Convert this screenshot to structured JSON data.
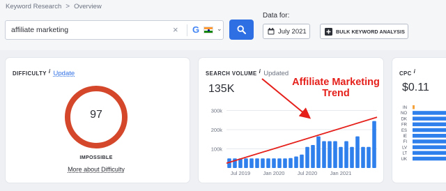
{
  "breadcrumb": {
    "items": [
      "Keyword Research",
      "Overview"
    ],
    "separator": ">"
  },
  "search": {
    "value": "affiliate marketing",
    "engine": "G",
    "country": "India"
  },
  "data_for": {
    "label": "Data for:",
    "date": "July 2021"
  },
  "bulk_button": "BULK KEYWORD ANALYSIS",
  "difficulty": {
    "title": "DIFFICULTY",
    "info": "i",
    "link": "Update",
    "value": "97",
    "level": "IMPOSSIBLE",
    "more": "More about Difficulty",
    "color": "#d4472a"
  },
  "search_volume": {
    "title": "SEARCH VOLUME",
    "info": "i",
    "status": "Updated",
    "value": "135K"
  },
  "cpc": {
    "title": "CPC",
    "info": "i",
    "value": "$0.11"
  },
  "annotation": {
    "line1": "Affiliate Marketing",
    "line2": "Trend",
    "color": "#e5201b"
  },
  "chart_data": [
    {
      "type": "bar",
      "title": "",
      "ytick_labels": [
        "100k",
        "200k",
        "300k"
      ],
      "ylim": [
        0,
        320000
      ],
      "xtick_labels": [
        "Jul 2019",
        "Jan 2020",
        "Jul 2020",
        "Jan 2021"
      ],
      "categories": [
        "May 2019",
        "Jun 2019",
        "Jul 2019",
        "Aug 2019",
        "Sep 2019",
        "Oct 2019",
        "Nov 2019",
        "Dec 2019",
        "Jan 2020",
        "Feb 2020",
        "Mar 2020",
        "Apr 2020",
        "May 2020",
        "Jun 2020",
        "Jul 2020",
        "Aug 2020",
        "Sep 2020",
        "Oct 2020",
        "Nov 2020",
        "Dec 2020",
        "Jan 2021",
        "Feb 2021",
        "Mar 2021",
        "Apr 2021",
        "May 2021",
        "Jun 2021",
        "Jul 2021"
      ],
      "values": [
        50000,
        50000,
        50000,
        50000,
        50000,
        50000,
        50000,
        50000,
        50000,
        50000,
        50000,
        52000,
        60000,
        70000,
        110000,
        120000,
        165000,
        140000,
        140000,
        140000,
        110000,
        140000,
        110000,
        165000,
        110000,
        110000,
        245000
      ],
      "trendline": {
        "from": 25000,
        "to": 265000,
        "color": "#e5201b"
      },
      "color": "#2f80ed",
      "grid": true
    },
    {
      "type": "bar",
      "orientation": "horizontal",
      "title": "",
      "categories": [
        "IN",
        "NO",
        "DK",
        "FR",
        "ES",
        "IE",
        "FI",
        "LV",
        "LT",
        "UK"
      ],
      "values": [
        0.002,
        1,
        1,
        1,
        1,
        1,
        1,
        1,
        1,
        1
      ],
      "highlight": {
        "category": "IN",
        "color": "#f5a23a"
      },
      "color": "#2f80ed"
    }
  ]
}
